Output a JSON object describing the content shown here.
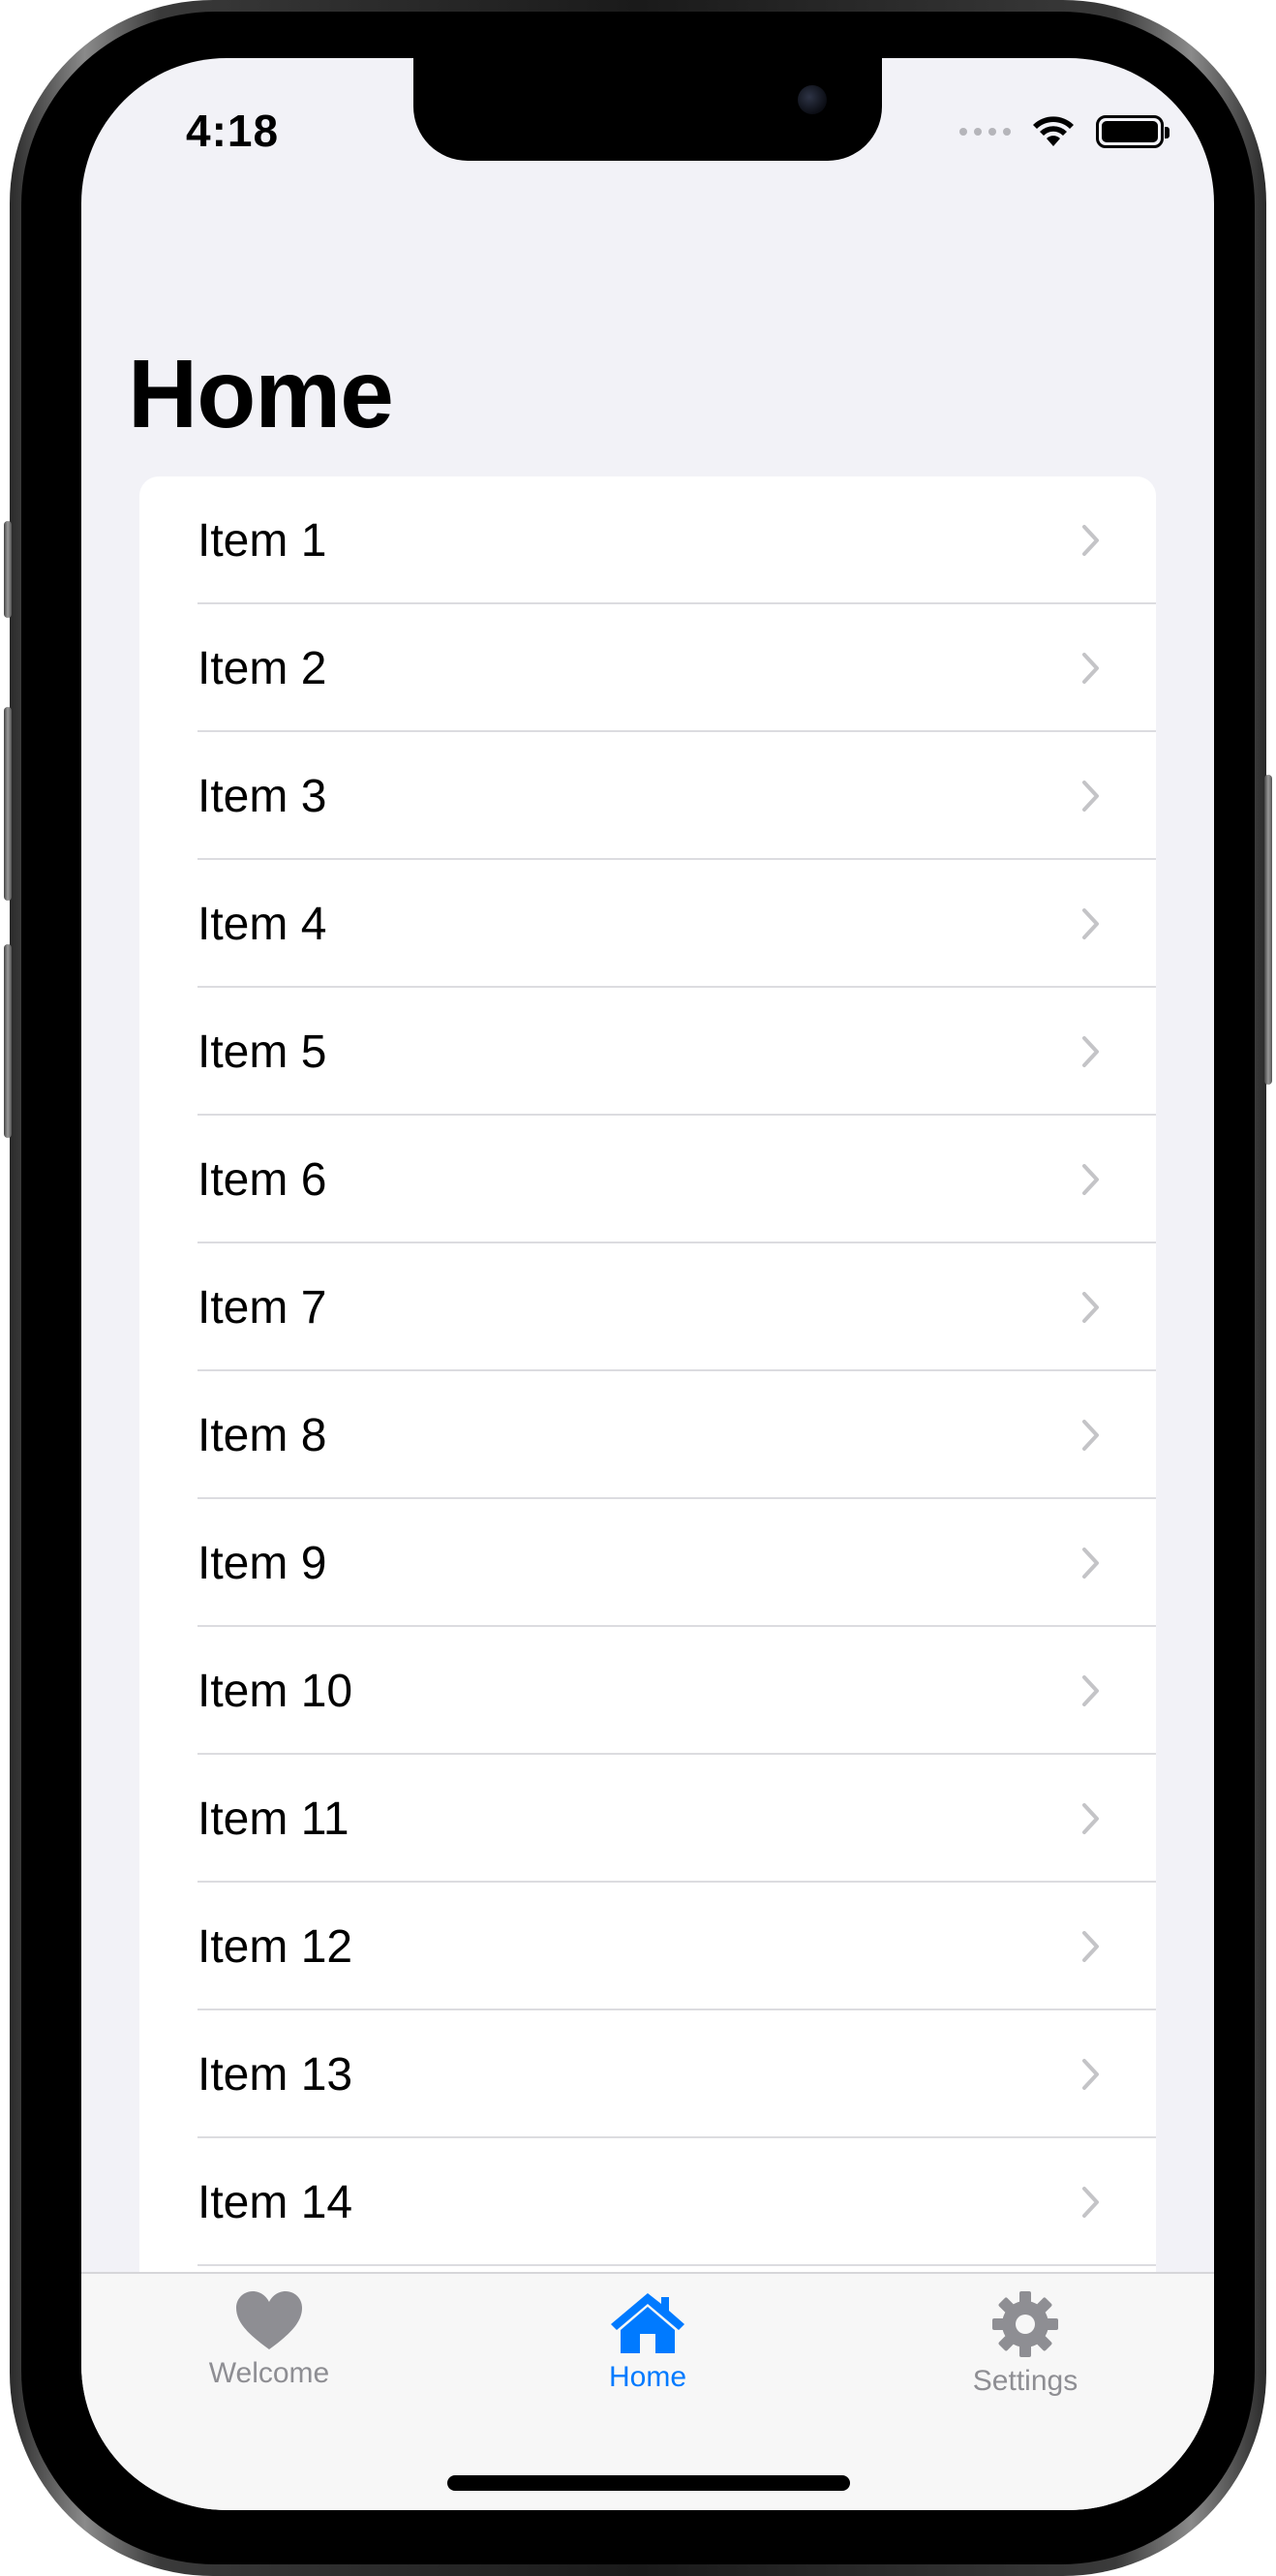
{
  "status_bar": {
    "time": "4:18"
  },
  "page": {
    "title": "Home"
  },
  "list": {
    "items": [
      {
        "label": "Item 1"
      },
      {
        "label": "Item 2"
      },
      {
        "label": "Item 3"
      },
      {
        "label": "Item 4"
      },
      {
        "label": "Item 5"
      },
      {
        "label": "Item 6"
      },
      {
        "label": "Item 7"
      },
      {
        "label": "Item 8"
      },
      {
        "label": "Item 9"
      },
      {
        "label": "Item 10"
      },
      {
        "label": "Item 11"
      },
      {
        "label": "Item 12"
      },
      {
        "label": "Item 13"
      },
      {
        "label": "Item 14"
      }
    ],
    "row_icon": "chevron-right-icon"
  },
  "tab_bar": {
    "tabs": [
      {
        "label": "Welcome",
        "icon": "heart-icon",
        "selected": false
      },
      {
        "label": "Home",
        "icon": "house-icon",
        "selected": true
      },
      {
        "label": "Settings",
        "icon": "gear-icon",
        "selected": false
      }
    ]
  },
  "colors": {
    "accent": "#007aff",
    "inactive_tab": "#8e8e93",
    "background": "#f2f2f7",
    "chevron": "#c4c4c7"
  }
}
